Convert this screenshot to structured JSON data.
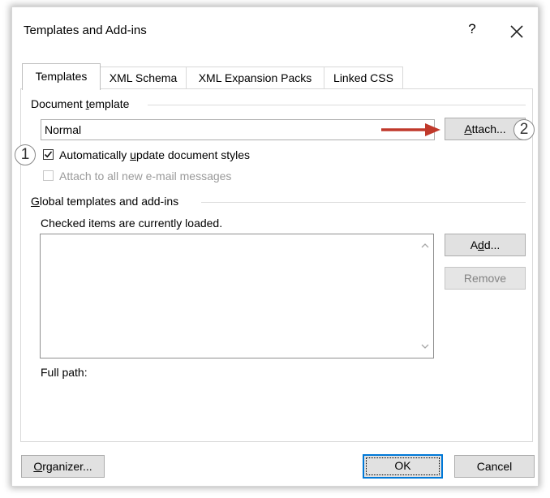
{
  "dialog": {
    "title": "Templates and Add-ins",
    "help_glyph": "?"
  },
  "tabs": [
    {
      "label": "Templates",
      "active": true
    },
    {
      "label": "XML Schema",
      "active": false
    },
    {
      "label": "XML Expansion Packs",
      "active": false
    },
    {
      "label": "Linked CSS",
      "active": false
    }
  ],
  "document_template": {
    "label_pre": "Document ",
    "label_access": "t",
    "label_post": "emplate",
    "value": "Normal",
    "attach_access": "A",
    "attach_rest": "ttach...",
    "auto_update": {
      "pre": "Automatically ",
      "access": "u",
      "post": "pdate document styles",
      "checked": true
    },
    "attach_email": {
      "label": "Attach to all new e-mail messages",
      "checked": false,
      "disabled": true
    }
  },
  "global": {
    "label_access": "G",
    "label_rest": "lobal templates and add-ins",
    "hint": "Checked items are currently loaded.",
    "items": [],
    "add_pre": "A",
    "add_access": "d",
    "add_post": "d...",
    "remove_label": "Remove",
    "full_path_label": "Full path:"
  },
  "footer": {
    "organizer_access": "O",
    "organizer_rest": "rganizer...",
    "ok_label": "OK",
    "cancel_label": "Cancel"
  },
  "annotations": {
    "step1": "1",
    "step2": "2",
    "arrow_color": "#c0392b"
  },
  "colors": {
    "focus_blue": "#0078d7",
    "button_gray": "#e1e1e1"
  }
}
